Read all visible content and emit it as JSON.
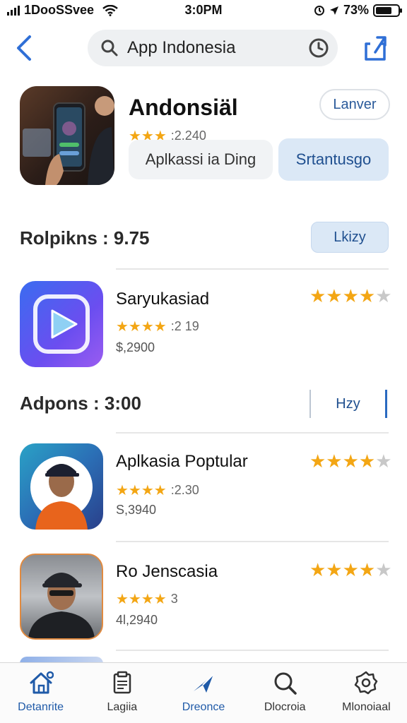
{
  "status_bar": {
    "carrier": "1DooSSvee",
    "time": "3:0PM",
    "battery": "73%",
    "battery_level": 0.73
  },
  "header": {
    "search_value": "App Indonesia",
    "icons": [
      "back-chevron-icon",
      "search-icon",
      "clock-icon",
      "share-icon"
    ]
  },
  "featured": {
    "title": "Andonsiäl",
    "rating_text": ":2.240",
    "rating_stars": 3,
    "button_outline": "Lanver",
    "button_gray": "Aplkassi ia Ding",
    "button_blue": "Srtantusgo"
  },
  "sections": [
    {
      "title": "Rolpikns : 9.75",
      "button": "Lkizy"
    },
    {
      "title": "Adpons : 3:00",
      "button": "Hzy"
    }
  ],
  "apps": [
    {
      "name": "Saryukasiad",
      "rating_text": ":2 19",
      "price": "$,2900",
      "stars": 4
    },
    {
      "name": "Aplkasia Poptular",
      "rating_text": ":2.30",
      "price": "S,3940",
      "stars": 4
    },
    {
      "name": "Ro Jenscasia",
      "rating_text": "3",
      "price": "4l,2940",
      "stars": 4
    }
  ],
  "tabs": [
    {
      "label": "Detanrite",
      "icon": "home-icon",
      "active": true
    },
    {
      "label": "Lagiia",
      "icon": "document-icon",
      "active": false
    },
    {
      "label": "Dreonce",
      "icon": "send-icon",
      "active": true
    },
    {
      "label": "Dlocroia",
      "icon": "magnifier-icon",
      "active": false
    },
    {
      "label": "Mlonoiaal",
      "icon": "settings-badge-icon",
      "active": false
    }
  ],
  "colors": {
    "accent": "#1f5aa8",
    "star": "#f3a614",
    "star_off": "#c8c8c8",
    "button_blue_bg": "#dbe8f6"
  }
}
